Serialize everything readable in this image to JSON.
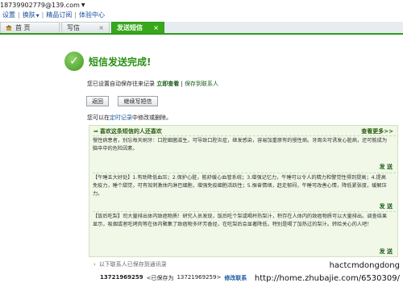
{
  "account": {
    "email": "18739902779@139.com"
  },
  "menu": [
    {
      "label": "设置"
    },
    {
      "label": "换肤"
    },
    {
      "label": "精品订阅"
    },
    {
      "label": "体验中心"
    }
  ],
  "tabs": [
    {
      "label": "首 页"
    },
    {
      "label": "写信"
    },
    {
      "label": "发送短信"
    }
  ],
  "result": {
    "title": "短信发送完成!",
    "save_note_prefix": "您已设置自动保存往来记录",
    "view_now": "立即查看",
    "save_to_contacts": "保存到联系人"
  },
  "buttons": {
    "back": "返回",
    "continue": "继续写短信"
  },
  "manage_note": {
    "prefix": "您可以在",
    "link": "定时记录",
    "suffix": "中修改或删除。"
  },
  "panel": {
    "title": "喜欢这条短信的人还喜欢",
    "more": "查看更多>>",
    "send_label": "发 送",
    "messages": [
      "慢性病患者，别忘每天刷牙：口腔细菌滋生，可导致口腔炎症，继发感染，容易加重原有的慢性病。牙周炎可诱发心脏病，还可能成为脑卒中的危险因素。",
      "【午睡五大好处】1.有助降低血压；2.保护心脏，能舒缓心血管系统；3.增强记忆力，午睡可以令人的精力和警觉性得到提高；4.提高免疫力，睡个甜觉，可有效刺激体内淋巴细胞，增强免疫细胞活跃性；5.振奋情绪，赶走郁闷，午睡可改善心情，降低紧张度，缓解压力。",
      "【饭后吃梨】司大量排出体内致癌物质！研究人员发现，饭后吃个梨或喝杯热梨汁，积存在人体内的致癌物质可以大量排出。调查结果显示，吸烟或者吃烤肉等在体内聚集了致癌物多环芳香烃，在吃梨后会显著降低，特别是喝了加热过的梨汁。转给关心的人吧！"
    ]
  },
  "saved_contacts": {
    "label": "以下联系人已保存到通讯录",
    "number": "13721969259",
    "saved_as": "<已保存为",
    "saved_name": "13721969259>",
    "edit": "修改联系"
  },
  "watermark": {
    "line1": "hactcmdongdong",
    "line2": "http://home.zhubajie.com/6530309/"
  }
}
